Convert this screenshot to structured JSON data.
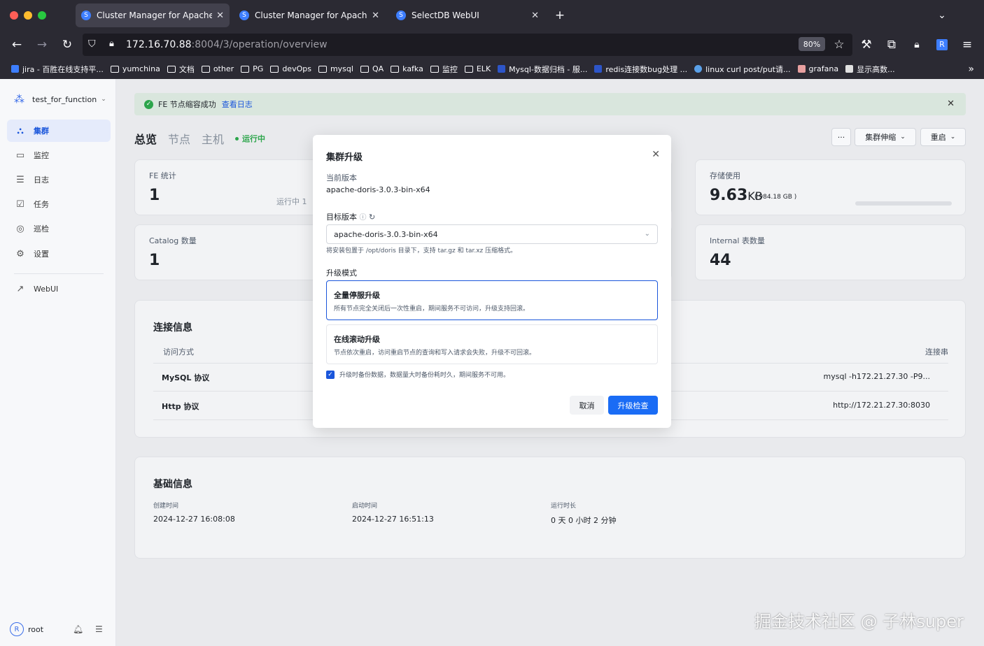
{
  "browser": {
    "tabs": [
      {
        "label": "Cluster Manager for Apache Doris",
        "active": true
      },
      {
        "label": "Cluster Manager for Apache Doris",
        "active": false
      },
      {
        "label": "SelectDB WebUI",
        "active": false
      }
    ],
    "url_host": "172.16.70.88",
    "url_path": ":8004/3/operation/overview",
    "zoom": "80%",
    "bookmarks": [
      "jira - 百胜在线支持平...",
      "yumchina",
      "文档",
      "other",
      "PG",
      "devOps",
      "mysql",
      "QA",
      "kafka",
      "监控",
      "ELK",
      "Mysql-数据归档 - 服...",
      "redis连接数bug处理 ...",
      "linux curl post/put请...",
      "grafana",
      "显示高数..."
    ]
  },
  "sidebar": {
    "cluster_name": "test_for_function",
    "items": [
      {
        "label": "集群",
        "icon": "cluster-icon",
        "active": true
      },
      {
        "label": "监控",
        "icon": "monitor-icon",
        "active": false
      },
      {
        "label": "日志",
        "icon": "log-icon",
        "active": false
      },
      {
        "label": "任务",
        "icon": "task-icon",
        "active": false
      },
      {
        "label": "巡检",
        "icon": "inspect-icon",
        "active": false
      },
      {
        "label": "设置",
        "icon": "gear-icon",
        "active": false
      }
    ],
    "webui": "WebUI",
    "user_initial": "R",
    "user": "root"
  },
  "alert": {
    "text": "FE 节点缩容成功",
    "link": "查看日志"
  },
  "page_tabs": [
    "总览",
    "节点",
    "主机"
  ],
  "status": "运行中",
  "toolbar": {
    "more": "···",
    "scale": "集群伸缩",
    "restart": "重启"
  },
  "cards": {
    "fe": {
      "title": "FE 统计",
      "value": "1",
      "running": "运行中  1"
    },
    "storage": {
      "title": "存储使用",
      "value": "9.63",
      "unit": "KB",
      "total": "( 984.18 GB )"
    },
    "catalog": {
      "title": "Catalog 数量",
      "value": "1"
    },
    "internal": {
      "title": "Internal 表数量",
      "value": "44"
    }
  },
  "connection": {
    "title": "连接信息",
    "col_method": "访问方式",
    "col_conn": "连接串",
    "rows": [
      {
        "method": "MySQL 协议",
        "conn": "mysql -h172.21.27.30 -P9..."
      },
      {
        "method": "Http 协议",
        "conn": "http://172.21.27.30:8030"
      }
    ]
  },
  "basic": {
    "title": "基础信息",
    "created_label": "创建时间",
    "created": "2024-12-27 16:08:08",
    "started_label": "启动时间",
    "started": "2024-12-27 16:51:13",
    "uptime_label": "运行时长",
    "uptime": "0 天 0 小时 2 分钟"
  },
  "modal": {
    "title": "集群升级",
    "current_label": "当前版本",
    "current": "apache-doris-3.0.3-bin-x64",
    "target_label": "目标版本",
    "target": "apache-doris-3.0.3-bin-x64",
    "hint": "将安装包置于 /opt/doris 目录下，支持 tar.gz 和 tar.xz 压缩格式。",
    "mode_label": "升级模式",
    "options": [
      {
        "title": "全量停服升级",
        "desc": "所有节点完全关闭后一次性重启，期间服务不可访问，升级支持回滚。",
        "selected": true
      },
      {
        "title": "在线滚动升级",
        "desc": "节点依次重启，访问重启节点的查询和写入请求会失败，升级不可回滚。",
        "selected": false
      }
    ],
    "backup": "升级时备份数据，数据量大时备份耗时久，期间服务不可用。",
    "cancel": "取消",
    "confirm": "升级检查"
  },
  "watermark": "掘金技术社区 @ 子林super"
}
